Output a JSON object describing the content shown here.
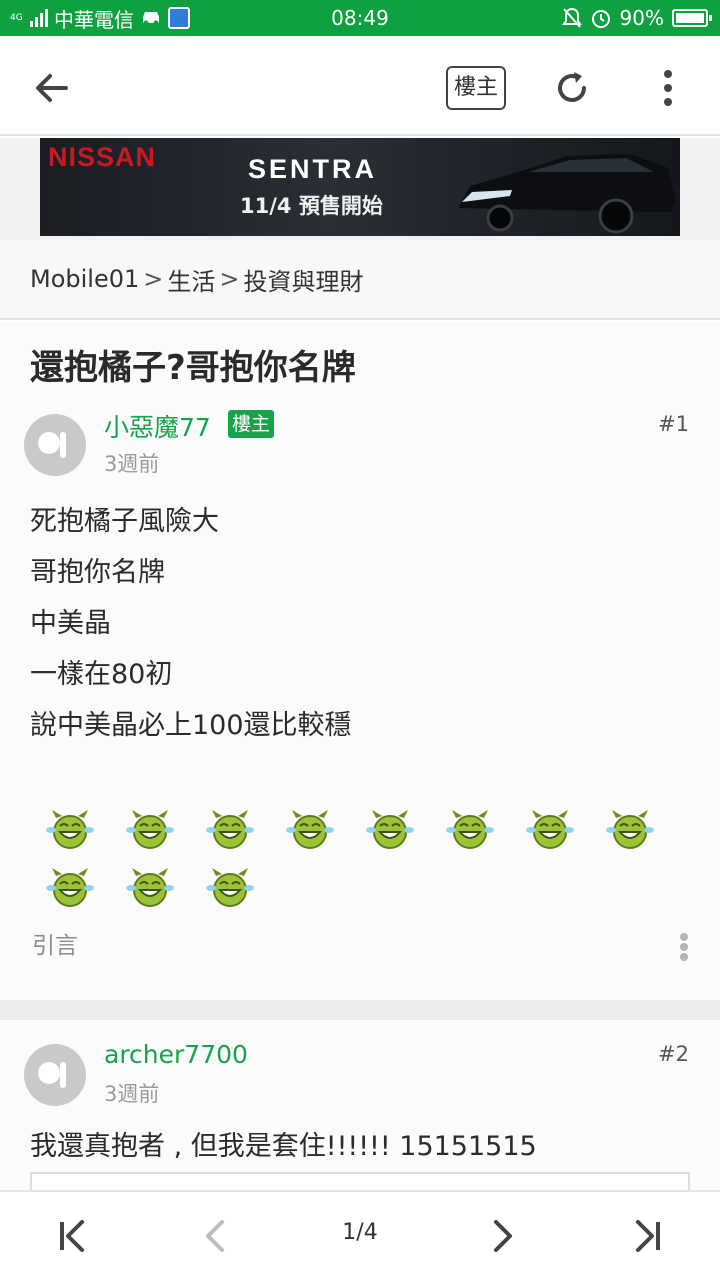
{
  "status_bar": {
    "network": "4G",
    "carrier": "中華電信",
    "time": "08:49",
    "battery": "90%",
    "battery_level": 0.9
  },
  "toolbar": {
    "back_icon": "arrow-left-icon",
    "op_filter_label": "樓主",
    "refresh_icon": "refresh-icon",
    "more_icon": "more-vertical-icon"
  },
  "ad": {
    "brand": "NISSAN",
    "model": "SENTRA",
    "date_text": "11/4 預售開始"
  },
  "breadcrumb": {
    "items": [
      "Mobile01",
      "生活",
      "投資與理財"
    ],
    "separator": ">"
  },
  "thread": {
    "title": "還抱橘子?哥抱你名牌"
  },
  "posts": [
    {
      "username": "小惡魔77",
      "badge": "樓主",
      "time": "3週前",
      "floor": "#1",
      "lines": [
        "死抱橘子風險大",
        "哥抱你名牌",
        "中美晶",
        "一樣在80初",
        "說中美晶必上100還比較穩"
      ],
      "emoticon_icon": "crying-laughing-devil-icon",
      "emoticon_count": 11,
      "quote_label": "引言"
    },
    {
      "username": "archer7700",
      "time": "3週前",
      "floor": "#2",
      "text": "我還真抱者 , 但我是套住!!!!!! 15151515"
    }
  ],
  "pager": {
    "page_label": "1/4",
    "first_icon": "first-page-icon",
    "prev_icon": "chevron-left-icon",
    "next_icon": "chevron-right-icon",
    "last_icon": "last-page-icon"
  },
  "colors": {
    "status_bar": "#0fa040",
    "username": "#16a34a",
    "badge": "#16a34a",
    "ad_brand": "#c71a23"
  }
}
